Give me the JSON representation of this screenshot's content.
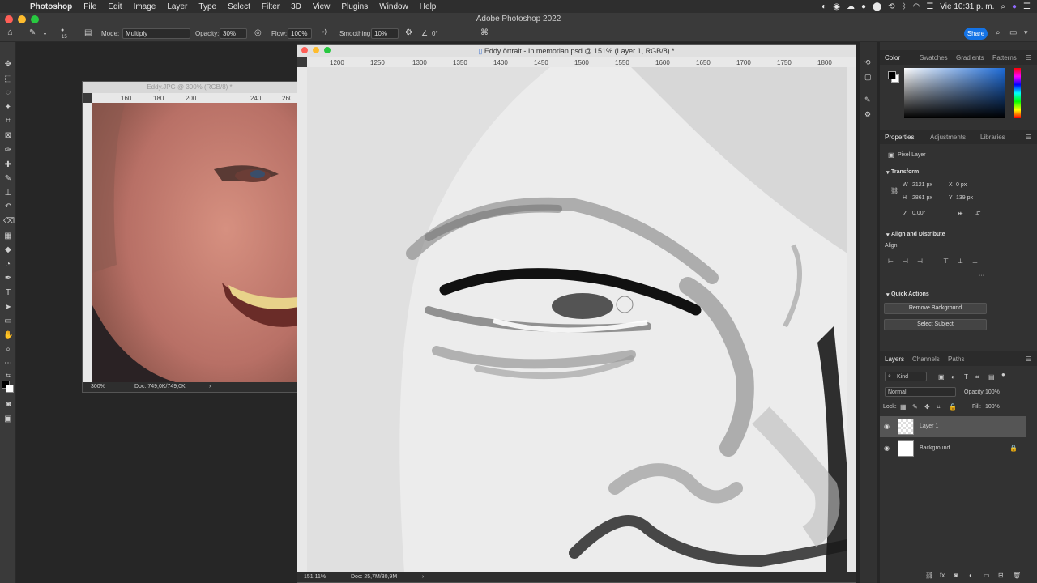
{
  "menubar": {
    "app": "Photoshop",
    "items": [
      "File",
      "Edit",
      "Image",
      "Layer",
      "Type",
      "Select",
      "Filter",
      "3D",
      "View",
      "Plugins",
      "Window",
      "Help"
    ],
    "clock": "Vie 10:31 p. m."
  },
  "window": {
    "title": "Adobe Photoshop 2022"
  },
  "options": {
    "brush_size": "15",
    "mode_label": "Mode:",
    "mode_value": "Multiply",
    "opacity_label": "Opacity:",
    "opacity_value": "30%",
    "flow_label": "Flow:",
    "flow_value": "100%",
    "smoothing_label": "Smoothing:",
    "smoothing_value": "10%",
    "angle_value": "0°",
    "share_label": "Share"
  },
  "doc_reference": {
    "title": "Eddy.JPG @ 300% (RGB/8) *",
    "ruler_ticks": [
      "160",
      "180",
      "200",
      "240",
      "260"
    ],
    "zoom": "300%",
    "doc_size": "Doc: 749,0K/749,0K"
  },
  "doc_main": {
    "title": "Eddy òrtrait - In memorian.psd @ 151% (Layer 1, RGB/8) *",
    "ruler_ticks": [
      "1200",
      "1250",
      "1300",
      "1350",
      "1400",
      "1450",
      "1500",
      "1550",
      "1600",
      "1650",
      "1700",
      "1750",
      "1800"
    ],
    "zoom": "151,11%",
    "doc_size": "Doc: 25,7M/30,9M"
  },
  "color_panel": {
    "tabs": [
      "Color",
      "Swatches",
      "Gradients",
      "Patterns"
    ],
    "foreground": "#000000",
    "background": "#ffffff"
  },
  "properties_panel": {
    "tabs": [
      "Properties",
      "Adjustments",
      "Libraries"
    ],
    "type": "Pixel Layer",
    "transform_title": "Transform",
    "w_label": "W",
    "w_value": "2121 px",
    "h_label": "H",
    "h_value": "2861 px",
    "x_label": "X",
    "x_value": "0 px",
    "y_label": "Y",
    "y_value": "139 px",
    "angle": "0,00°",
    "align_title": "Align and Distribute",
    "align_label": "Align:",
    "more": "···",
    "quick_actions_title": "Quick Actions",
    "remove_bg": "Remove Background",
    "select_subject": "Select Subject"
  },
  "layers_panel": {
    "tabs": [
      "Layers",
      "Channels",
      "Paths"
    ],
    "filter": "Kind",
    "blend_mode": "Normal",
    "opacity_label": "Opacity:",
    "opacity_value": "100%",
    "lock_label": "Lock:",
    "fill_label": "Fill:",
    "fill_value": "100%",
    "layers": [
      {
        "name": "Layer 1"
      },
      {
        "name": "Background"
      }
    ]
  }
}
